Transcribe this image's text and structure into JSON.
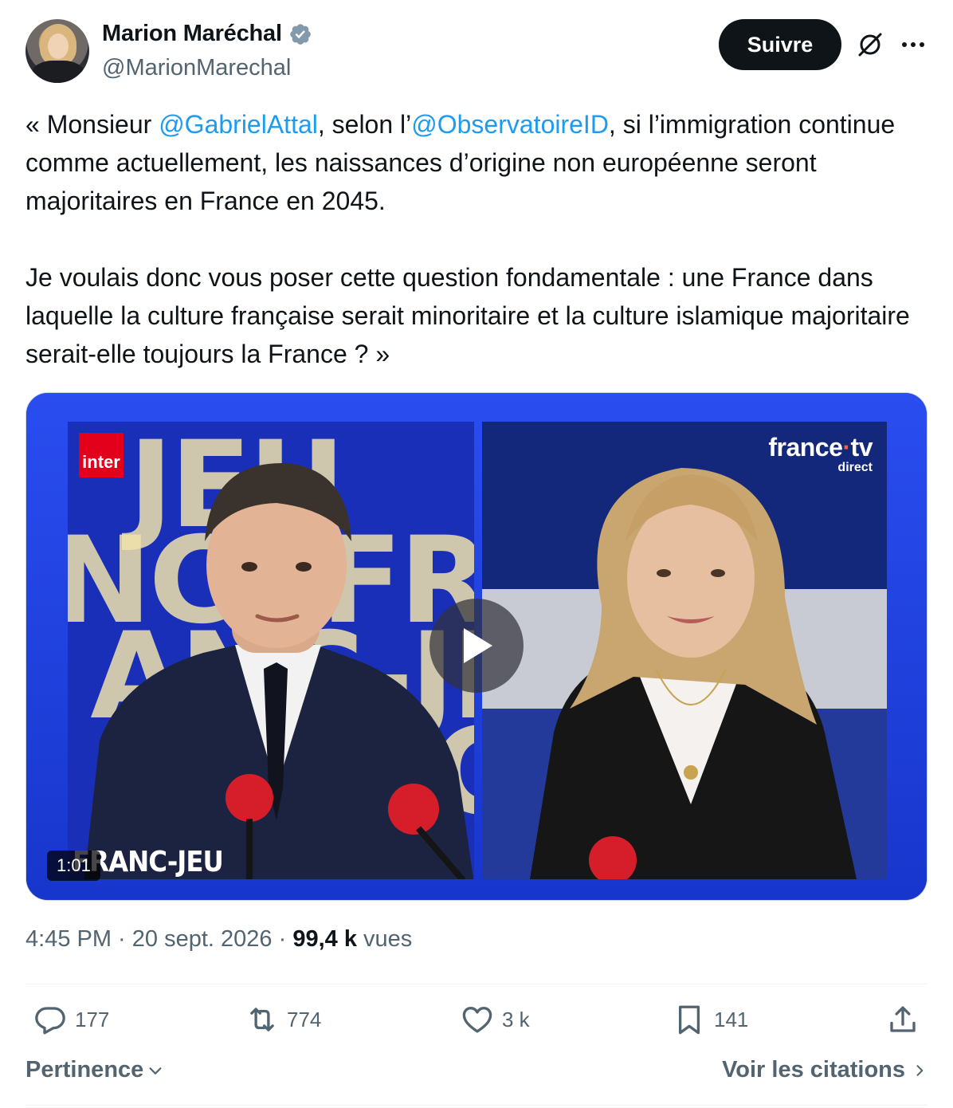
{
  "author": {
    "name": "Marion Maréchal",
    "handle": "@MarionMarechal",
    "verified": true,
    "avatar_icon": "avatar"
  },
  "header": {
    "follow_label": "Suivre",
    "grok_icon": "grok-icon",
    "more_icon": "more-icon"
  },
  "tweet": {
    "part1": "« Monsieur ",
    "mention1": "@GabrielAttal",
    "part2": ", selon l’",
    "mention2": "@ObservatoireID",
    "part3": ", si l’immigration continue comme actuellement, les naissances d’origine non européenne seront majoritaires en France en 2045.\n\nJe voulais donc vous poser cette question fondamentale : une France dans laquelle la culture française serait minoritaire et la culture islamique majoritaire serait-elle toujours la France ? »"
  },
  "media": {
    "duration": "1:01",
    "left_logo": "inter",
    "right_logo_main_a": "france",
    "right_logo_dot": "·",
    "right_logo_main_b": "tv",
    "right_logo_sub": "direct",
    "lower_label": "FRANC-JEU",
    "play_icon": "play-icon"
  },
  "meta": {
    "time": "4:45 PM",
    "sep1": " · ",
    "date": "20 sept. 2026",
    "sep2": " · ",
    "views_count": "99,4 k",
    "views_label": " vues"
  },
  "actions": {
    "replies": "177",
    "reposts": "774",
    "likes": "3 k",
    "bookmarks": "141"
  },
  "footer": {
    "sort_label": "Pertinence",
    "quotes_label": "Voir les citations"
  },
  "colors": {
    "link": "#1d9bf0",
    "secondary_text": "#536471",
    "primary_text": "#0f1419",
    "verified_badge": "#829aab"
  }
}
